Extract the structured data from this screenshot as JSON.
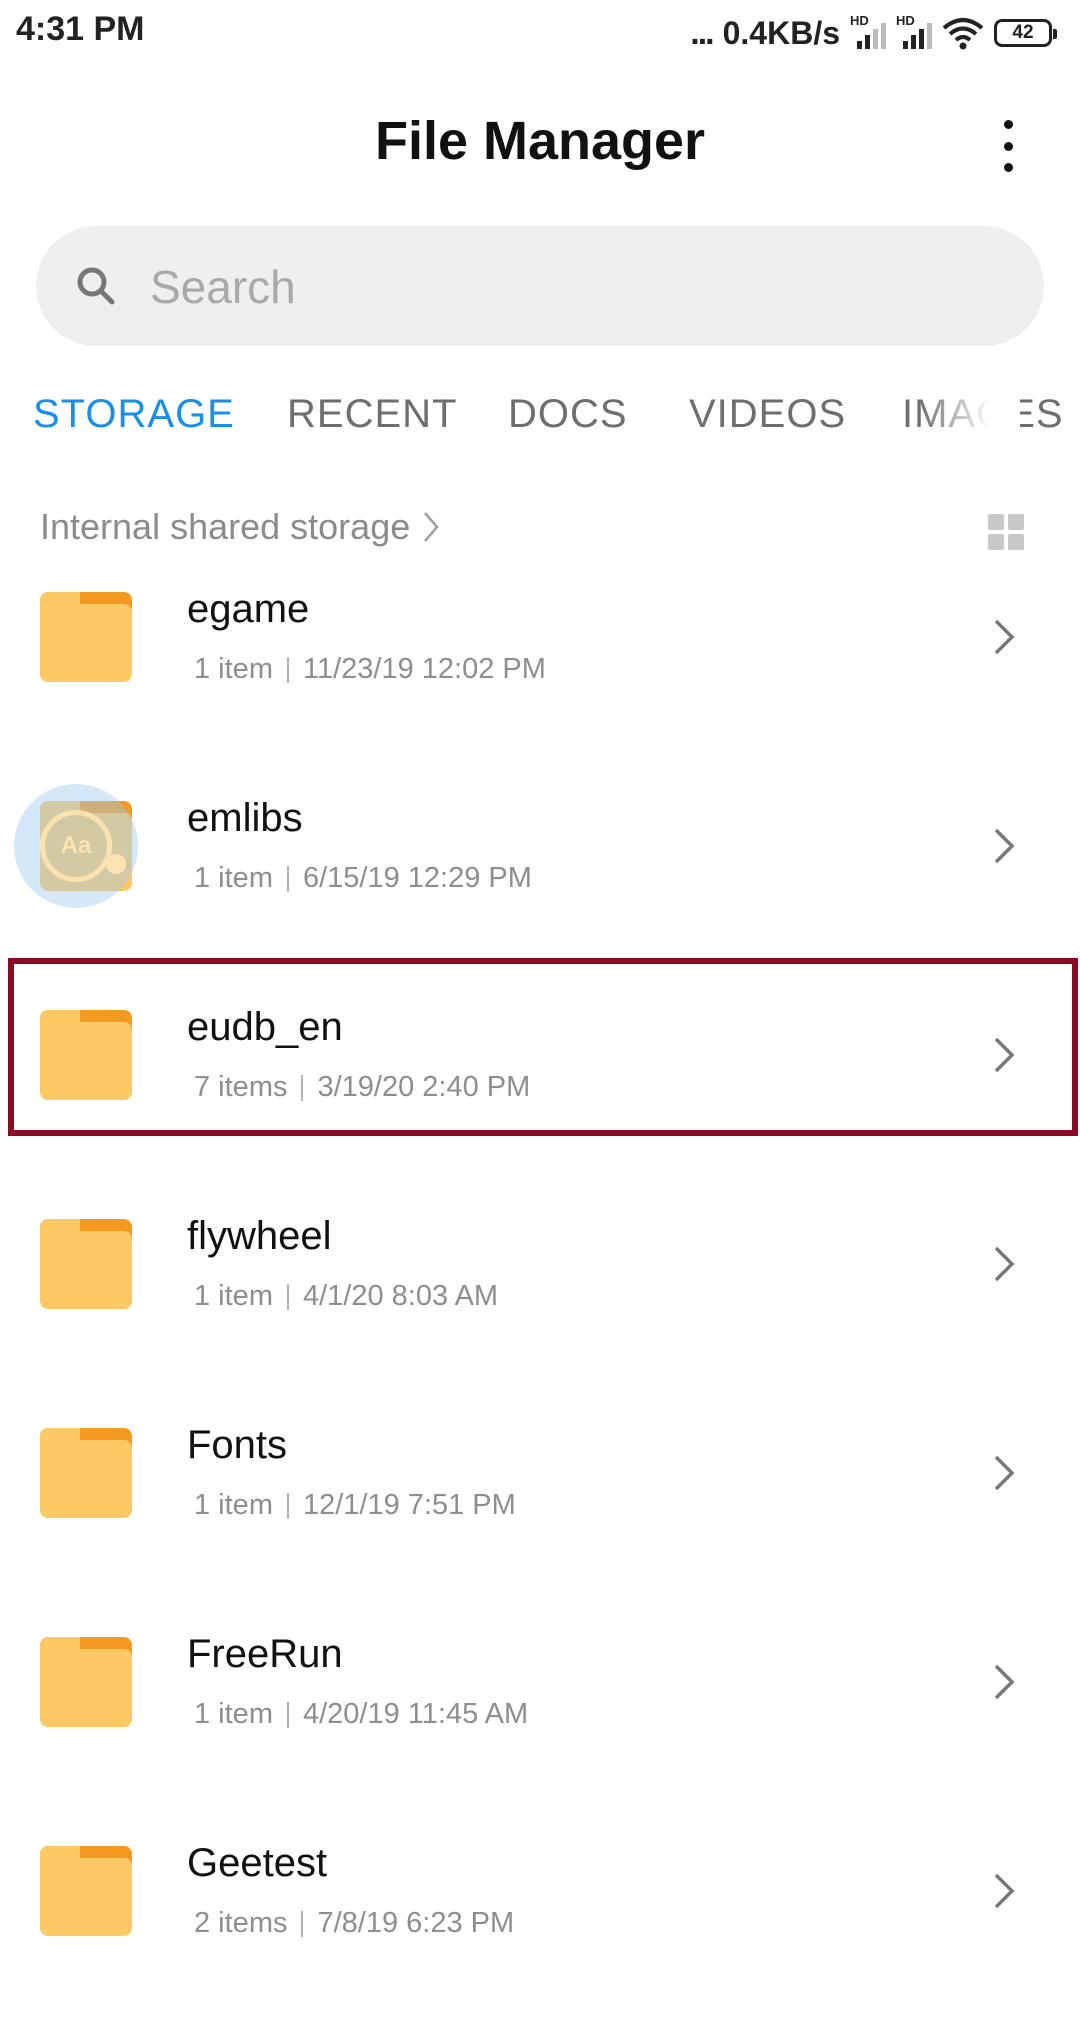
{
  "status_bar": {
    "time": "4:31 PM",
    "dots": "...",
    "speed": "0.4KB/s",
    "hd1": "HD",
    "hd2": "HD",
    "battery": "42"
  },
  "header": {
    "title": "File Manager"
  },
  "search": {
    "placeholder": "Search"
  },
  "tabs": [
    {
      "label": "STORAGE",
      "active": true
    },
    {
      "label": "RECENT"
    },
    {
      "label": "DOCS"
    },
    {
      "label": "VIDEOS"
    },
    {
      "label": "IMAGES"
    }
  ],
  "breadcrumb": {
    "label": "Internal shared storage"
  },
  "bubble": {
    "label": "Aa"
  },
  "files": [
    {
      "name": "egame",
      "count": "1 item",
      "date": "11/23/19 12:02 PM"
    },
    {
      "name": "emlibs",
      "count": "1 item",
      "date": "6/15/19 12:29 PM"
    },
    {
      "name": "eudb_en",
      "count": "7 items",
      "date": "3/19/20 2:40 PM"
    },
    {
      "name": "flywheel",
      "count": "1 item",
      "date": "4/1/20 8:03 AM"
    },
    {
      "name": "Fonts",
      "count": "1 item",
      "date": "12/1/19 7:51 PM"
    },
    {
      "name": "FreeRun",
      "count": "1 item",
      "date": "4/20/19 11:45 AM"
    },
    {
      "name": "Geetest",
      "count": "2 items",
      "date": "7/8/19 6:23 PM"
    }
  ]
}
